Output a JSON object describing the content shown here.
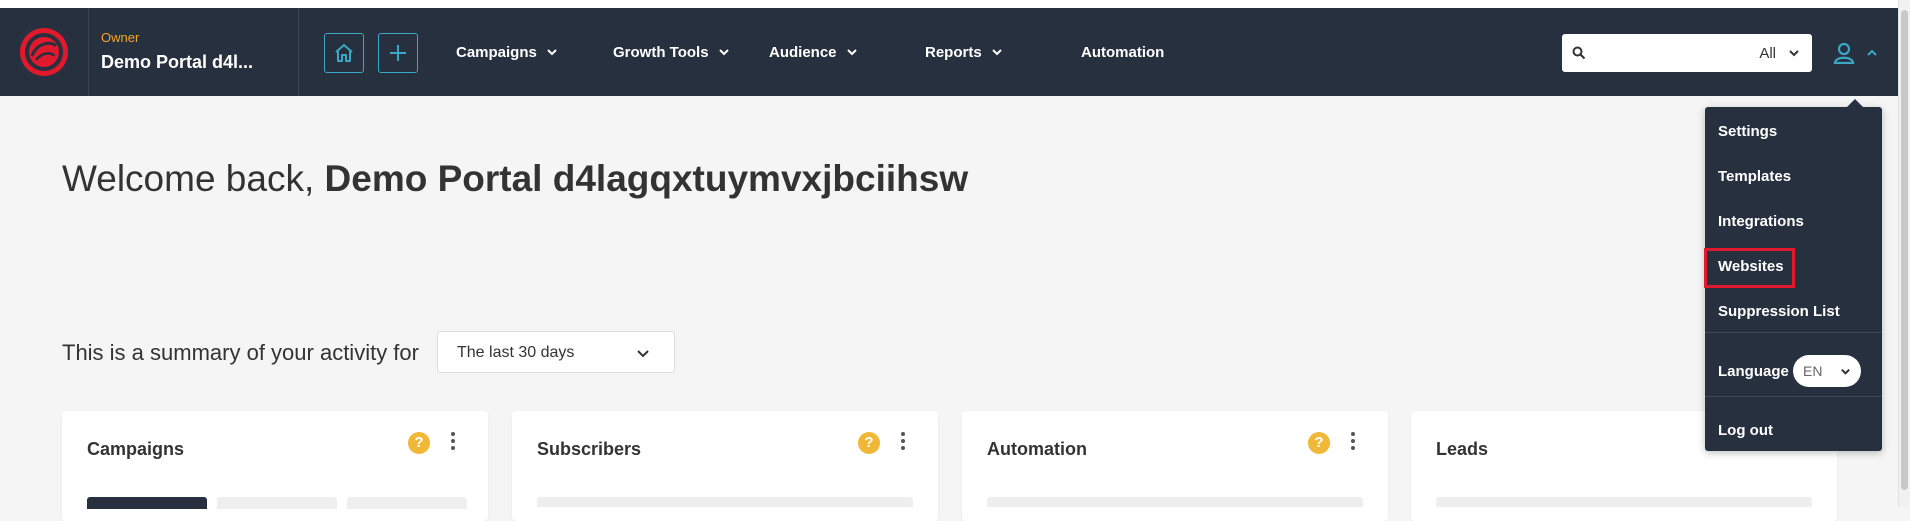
{
  "header": {
    "account_role": "Owner",
    "account_name": "Demo Portal d4l...",
    "nav": [
      "Campaigns",
      "Growth Tools",
      "Audience",
      "Reports",
      "Automation"
    ],
    "search": {
      "value": "",
      "filter": "All"
    }
  },
  "main": {
    "welcome_prefix": "Welcome back,",
    "welcome_name": "Demo Portal d4lagqxtuymvxjbciihsw",
    "summary_text": "This is a summary of your activity for",
    "range_value": "The last 30 days",
    "cards": [
      {
        "title": "Campaigns",
        "help": "?"
      },
      {
        "title": "Subscribers",
        "help": "?"
      },
      {
        "title": "Automation",
        "help": "?"
      },
      {
        "title": "Leads",
        "help": "?"
      }
    ]
  },
  "user_menu": {
    "items": [
      "Settings",
      "Templates",
      "Integrations",
      "Websites",
      "Suppression List"
    ],
    "language_label": "Language",
    "language_value": "EN",
    "logout": "Log out",
    "highlighted_item": "Websites"
  },
  "colors": {
    "nav_bg": "#27303f",
    "accent": "#3aa7c4",
    "brand_red": "#e0192d",
    "owner_orange": "#f5a623",
    "help_yellow": "#f1b737"
  },
  "icons": [
    "logo-icon",
    "home-icon",
    "plus-icon",
    "chevron-down-icon",
    "search-icon",
    "user-icon",
    "chevron-up-icon",
    "help-icon",
    "kebab-icon"
  ]
}
